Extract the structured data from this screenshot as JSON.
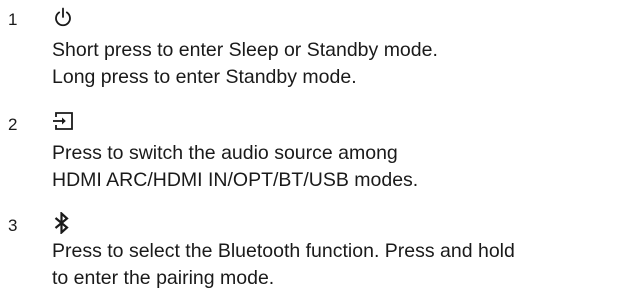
{
  "items": [
    {
      "number": "1",
      "icon": "power-icon",
      "lines": [
        "Short press to enter Sleep or Standby mode.",
        "Long press to enter Standby mode."
      ]
    },
    {
      "number": "2",
      "icon": "input-source-icon",
      "lines": [
        "Press to switch the audio source among",
        "HDMI ARC/HDMI IN/OPT/BT/USB modes."
      ]
    },
    {
      "number": "3",
      "icon": "bluetooth-icon",
      "lines": [
        "Press to select the Bluetooth function. Press and hold",
        "to enter the pairing mode."
      ]
    }
  ],
  "colors": {
    "text": "#1a1a1a",
    "background": "#ffffff"
  }
}
